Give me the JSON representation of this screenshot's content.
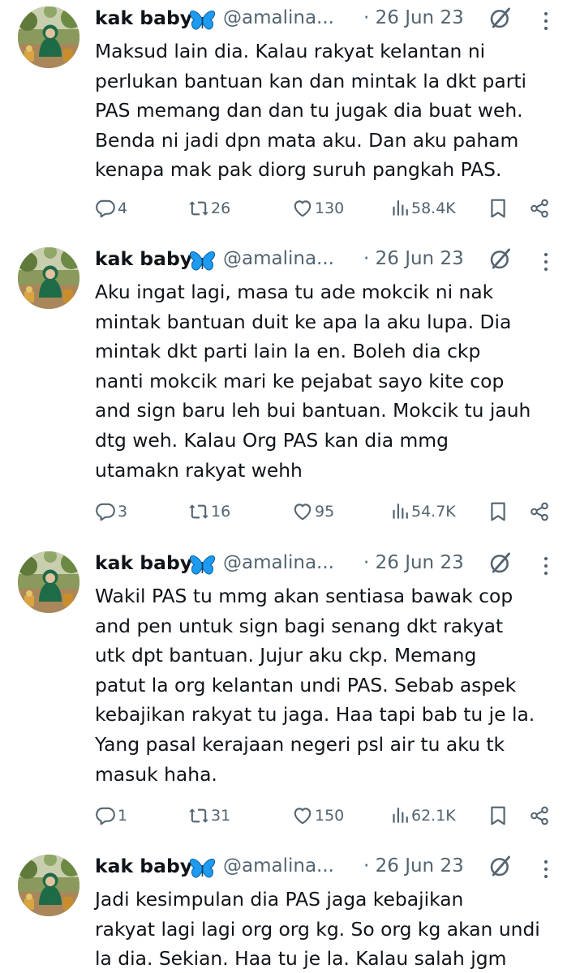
{
  "tweets": [
    {
      "name": "kak baby",
      "handle": "@amalina...",
      "time": "· 26 Jun 23",
      "text": "Maksud lain dia. Kalau rakyat kelantan ni\nperlukan bantuan kan dan mintak la dkt parti\nPAS memang dan dan tu jugak dia buat weh.\nBenda ni jadi dpn mata aku. Dan aku paham\nkenapa mak pak diorg suruh pangkah PAS.",
      "replies": "4",
      "retweets": "26",
      "likes": "130",
      "views": "58.4K"
    },
    {
      "name": "kak baby",
      "handle": "@amalina...",
      "time": "· 26 Jun 23",
      "text": "Aku ingat lagi, masa tu ade mokcik ni nak\nmintak bantuan duit ke apa la aku lupa. Dia\nmintak dkt parti lain la en. Boleh dia ckp\nnanti mokcik mari ke pejabat sayo kite cop\nand sign baru leh bui bantuan. Mokcik tu jauh\ndtg weh. Kalau Org PAS kan dia mmg\nutamakn rakyat wehh",
      "replies": "3",
      "retweets": "16",
      "likes": "95",
      "views": "54.7K"
    },
    {
      "name": "kak baby",
      "handle": "@amalina...",
      "time": "· 26 Jun 23",
      "text": "Wakil PAS tu mmg akan sentiasa bawak cop\nand pen untuk sign bagi senang dkt rakyat\nutk dpt bantuan. Jujur aku ckp. Memang\npatut la org kelantan undi PAS. Sebab aspek\nkebajikan rakyat tu jaga. Haa tapi bab tu je la.\nYang pasal kerajaan negeri psl air tu aku tk\nmasuk haha.",
      "replies": "1",
      "retweets": "31",
      "likes": "150",
      "views": "62.1K"
    },
    {
      "name": "kak baby",
      "handle": "@amalina...",
      "time": "· 26 Jun 23",
      "text": "Jadi kesimpulan dia PAS jaga kebajikan\nrakyat lagi lagi org org kg. So org kg akan undi\nla dia. Sekian. Haa tu je la. Kalau salah jgm",
      "replies": "",
      "retweets": "",
      "likes": "",
      "views": ""
    }
  ],
  "icons": {
    "avatar": "profile-photo",
    "name_emoji": "butterfly-icon",
    "grok": "grok-icon",
    "more": "more-icon",
    "reply": "reply-icon",
    "retweet": "retweet-icon",
    "like": "heart-icon",
    "views": "views-icon",
    "bookmark": "bookmark-icon",
    "share": "share-icon"
  },
  "colors": {
    "text": "#0f1419",
    "secondary": "#536471",
    "butterfly": "#1d9bf0"
  }
}
